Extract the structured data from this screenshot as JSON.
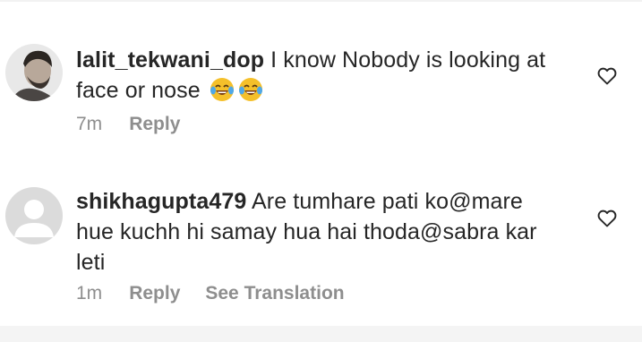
{
  "comments": [
    {
      "username": "lalit_tekwani_dop",
      "text": "I know Nobody is looking at face or nose",
      "emojis": [
        "tears-of-joy-emoji",
        "tears-of-joy-emoji"
      ],
      "time": "7m",
      "reply_label": "Reply",
      "avatar_icon": "user-photo-avatar"
    },
    {
      "username": "shikhagupta479",
      "text": "Are tumhare pati ko@mare hue kuchh hi samay hua hai thoda@sabra kar leti",
      "time": "1m",
      "reply_label": "Reply",
      "translate_label": "See Translation",
      "avatar_icon": "default-profile-avatar"
    }
  ],
  "colors": {
    "text": "#262626",
    "secondary": "#8e8e8e",
    "avatar_placeholder": "#dbdbdb"
  }
}
